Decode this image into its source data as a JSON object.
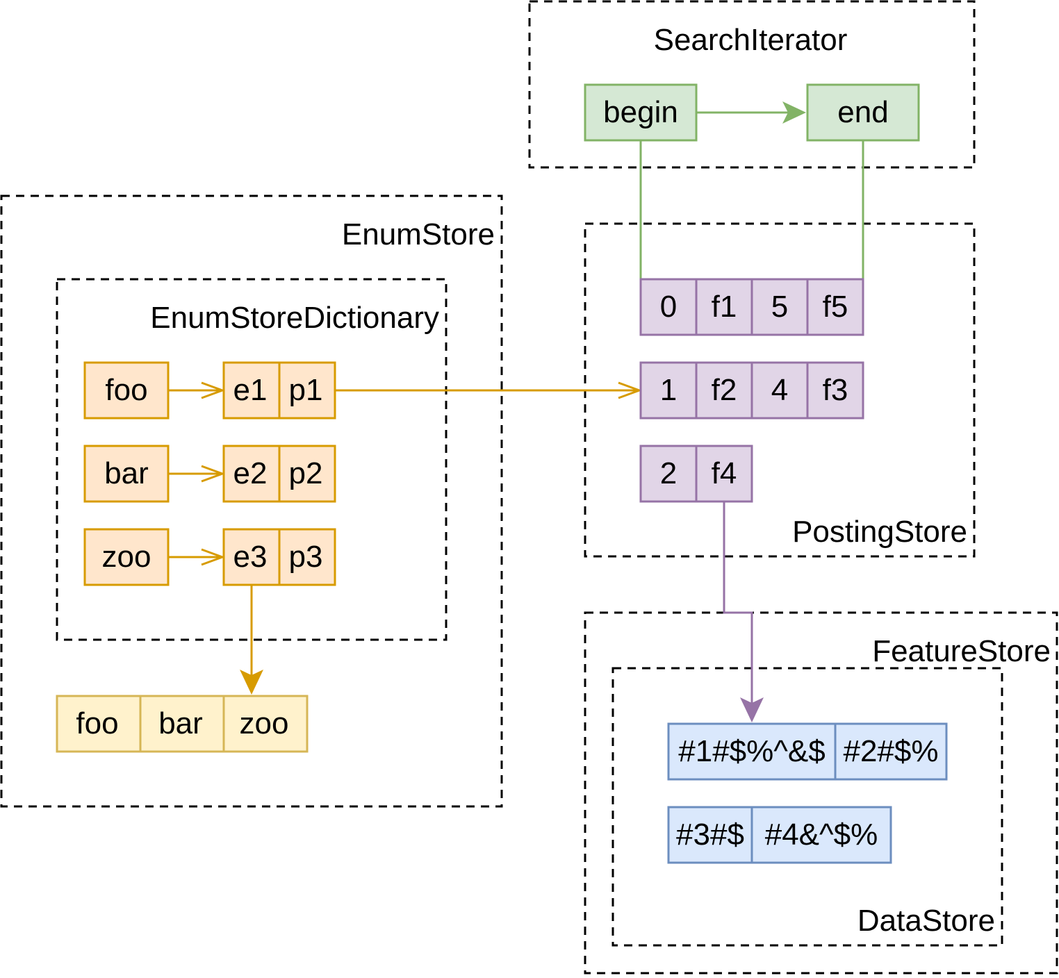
{
  "containers": {
    "search_iterator": "SearchIterator",
    "enum_store": "EnumStore",
    "enum_store_dictionary": "EnumStoreDictionary",
    "posting_store": "PostingStore",
    "feature_store": "FeatureStore",
    "data_store": "DataStore"
  },
  "search_iterator": {
    "begin": "begin",
    "end": "end"
  },
  "dictionary": {
    "keys": [
      "foo",
      "bar",
      "zoo"
    ],
    "entries": [
      [
        "e1",
        "p1"
      ],
      [
        "e2",
        "p2"
      ],
      [
        "e3",
        "p3"
      ]
    ]
  },
  "string_array": [
    "foo",
    "bar",
    "zoo"
  ],
  "postings": [
    [
      "0",
      "f1",
      "5",
      "f5"
    ],
    [
      "1",
      "f2",
      "4",
      "f3"
    ],
    [
      "2",
      "f4"
    ]
  ],
  "data_store": [
    [
      "#1#$%^&$",
      "#2#$%"
    ],
    [
      "#3#$",
      "#4&^$%"
    ]
  ],
  "colors": {
    "green_fill": "#d5e8d4",
    "green_stroke": "#82b366",
    "orange_fill": "#ffe6cc",
    "orange_stroke": "#d79b00",
    "yellow_fill": "#fff2cc",
    "yellow_stroke": "#d6b656",
    "purple_fill": "#e1d5e7",
    "purple_stroke": "#9673a6",
    "blue_fill": "#dae8fc",
    "blue_stroke": "#6c8ebf"
  }
}
